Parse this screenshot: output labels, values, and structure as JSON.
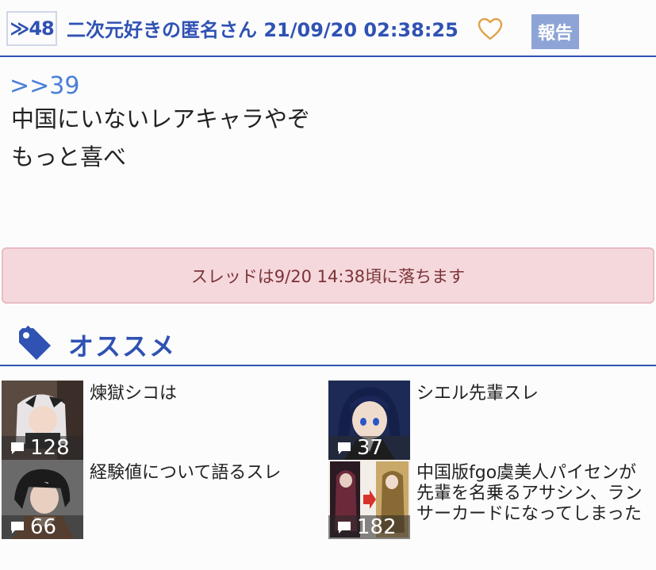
{
  "post": {
    "number": "≫48",
    "poster": "二次元好きの匿名さん 21/09/20 02:38:25",
    "report_label": "報告",
    "anchor": ">>39",
    "lines": [
      "中国にいないレアキャラやぞ",
      "もっと喜べ"
    ]
  },
  "notice": "スレッドは9/20 14:38頃に落ちます",
  "recommend": {
    "title": "オススメ",
    "items": [
      {
        "title": "煉獄シコは",
        "count": "128"
      },
      {
        "title": "シエル先輩スレ",
        "count": "37"
      },
      {
        "title": "経験値について語るスレ",
        "count": "66"
      },
      {
        "title": "中国版fgo虞美人パイセンが先輩を名乗るアサシン、ランサーカードになってしまった",
        "count": "182"
      }
    ]
  },
  "colors": {
    "accent": "#2f52b3",
    "link": "#4a7fd8",
    "report_bg": "#8ea4d6",
    "heart": "#e0a34a",
    "notice_bg": "#f5d8dc"
  }
}
